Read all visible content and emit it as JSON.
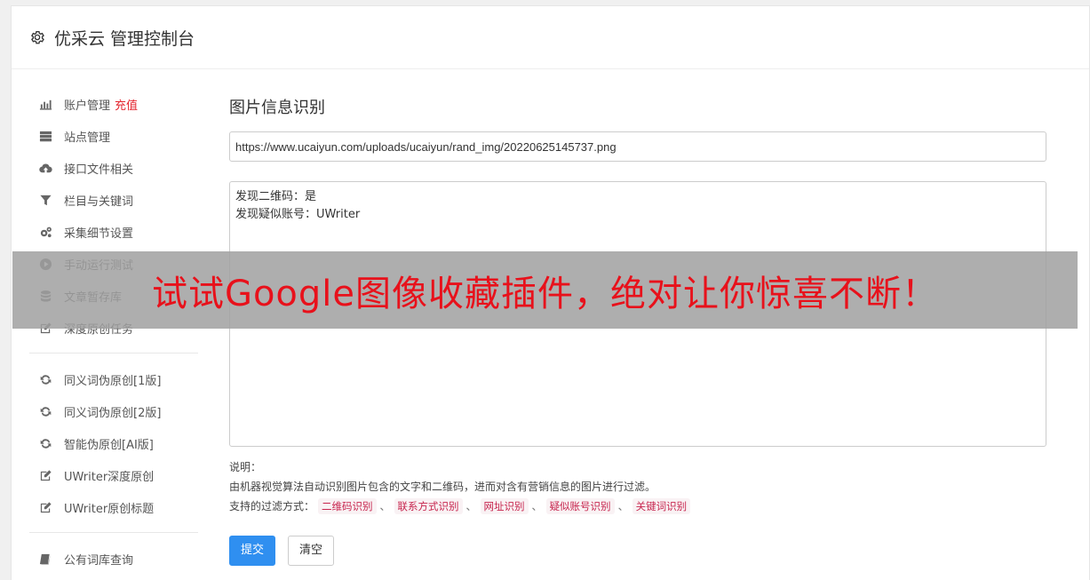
{
  "header": {
    "icon": "gear-icon",
    "title": "优采云 管理控制台"
  },
  "sidebar": {
    "group1": [
      {
        "icon": "bar-chart-icon",
        "label": "账户管理",
        "badge": "充值"
      },
      {
        "icon": "server-icon",
        "label": "站点管理"
      },
      {
        "icon": "cloud-upload-icon",
        "label": "接口文件相关"
      },
      {
        "icon": "filter-icon",
        "label": "栏目与关键词"
      },
      {
        "icon": "cogs-icon",
        "label": "采集细节设置"
      },
      {
        "icon": "play-circle-icon",
        "label": "手动运行测试"
      },
      {
        "icon": "database-icon",
        "label": "文章暂存库"
      },
      {
        "icon": "edit-icon",
        "label": "深度原创任务"
      }
    ],
    "group2": [
      {
        "icon": "refresh-icon",
        "label": "同义词伪原创[1版]"
      },
      {
        "icon": "refresh-icon",
        "label": "同义词伪原创[2版]"
      },
      {
        "icon": "refresh-icon",
        "label": "智能伪原创[AI版]"
      },
      {
        "icon": "edit-icon",
        "label": "UWriter深度原创"
      },
      {
        "icon": "edit-icon",
        "label": "UWriter原创标题"
      }
    ],
    "group3": [
      {
        "icon": "book-icon",
        "label": "公有词库查询"
      }
    ]
  },
  "main": {
    "title": "图片信息识别",
    "url_value": "https://www.ucaiyun.com/uploads/ucaiyun/rand_img/20220625145737.png",
    "result_lines": [
      "发现二维码：是",
      "发现疑似账号：UWriter"
    ],
    "help_title": "说明：",
    "help_text": "由机器视觉算法自动识别图片包含的文字和二维码，进而对含有营销信息的图片进行过滤。",
    "filters_label": "支持的过滤方式：",
    "filters": [
      "二维码识别",
      "联系方式识别",
      "网址识别",
      "疑似账号识别",
      "关键词识别"
    ],
    "filter_separator": "、",
    "submit_label": "提交",
    "clear_label": "清空"
  },
  "overlay": {
    "text": "试试Google图像收藏插件，绝对让你惊喜不断！"
  },
  "colors": {
    "primary": "#2f8ff0",
    "badge": "#e4262f",
    "tag_text": "#c7254e",
    "tag_bg": "#f9f2f4",
    "overlay_text": "#e8111b"
  }
}
